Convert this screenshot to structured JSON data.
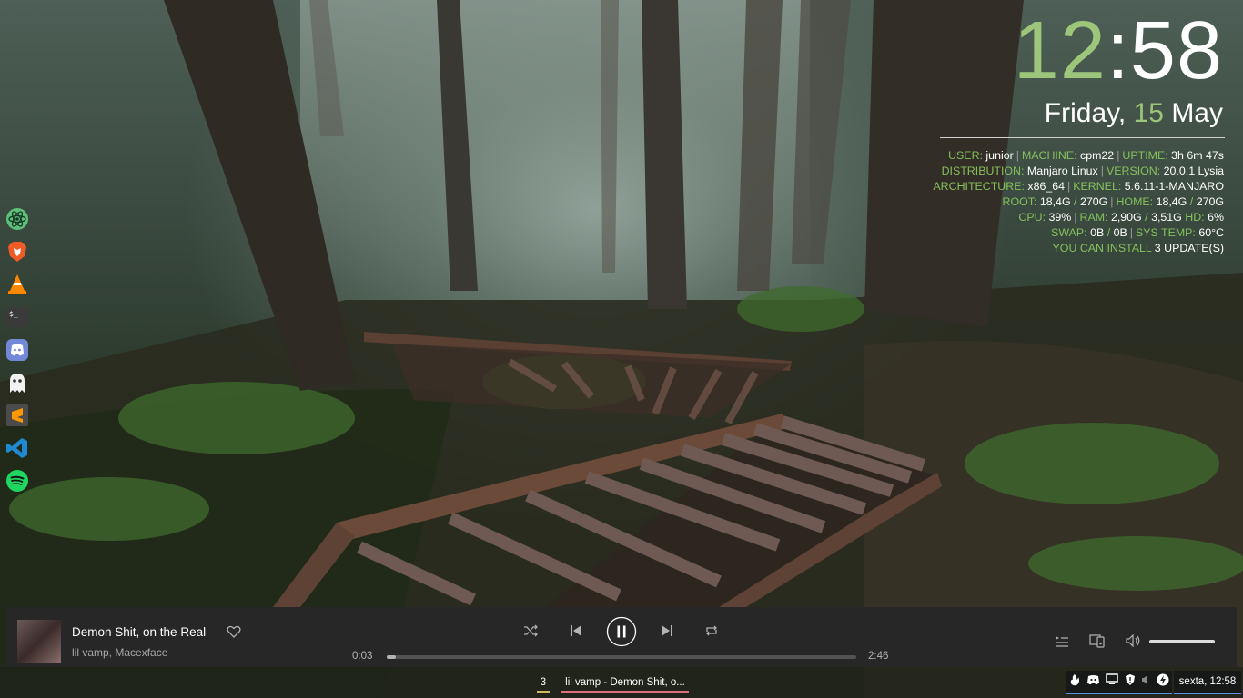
{
  "clock": {
    "hours": "12",
    "colon": ":",
    "minutes": "58"
  },
  "date": {
    "weekday": "Friday,",
    "day": "15",
    "month": "May"
  },
  "sysinfo": {
    "user_k": "USER:",
    "user_v": "junior",
    "machine_k": "MACHINE:",
    "machine_v": "cpm22",
    "uptime_k": "UPTIME:",
    "uptime_v": "3h 6m 47s",
    "dist_k": "DISTRIBUTION:",
    "dist_v": "Manjaro Linux",
    "ver_k": "VERSION:",
    "ver_v": "20.0.1 Lysia",
    "arch_k": "ARCHITECTURE:",
    "arch_v": "x86_64",
    "kernel_k": "KERNEL:",
    "kernel_v": "5.6.11-1-MANJARO",
    "root_k": "ROOT:",
    "root_used": "18,4G",
    "root_total": "270G",
    "home_k": "HOME:",
    "home_used": "18,4G",
    "home_total": "270G",
    "cpu_k": "CPU:",
    "cpu_v": "39%",
    "ram_k": "RAM:",
    "ram_used": "2,90G",
    "ram_total": "3,51G",
    "hd_k": "HD:",
    "hd_v": "6%",
    "swap_k": "SWAP:",
    "swap_used": "0B",
    "swap_total": "0B",
    "temp_k": "SYS TEMP:",
    "temp_v": "60°C",
    "updates_k": "YOU CAN INSTALL",
    "updates_v": "3 UPDATE(S)",
    "pipe": "|",
    "slash": "/"
  },
  "dock": [
    "atom-icon",
    "brave-icon",
    "vlc-icon",
    "terminal-icon",
    "discord-icon",
    "ghost-icon",
    "sublime-text-icon",
    "vscode-icon",
    "spotify-icon"
  ],
  "player": {
    "title": "Demon Shit, on the Real",
    "artist": "lil vamp, Macexface",
    "elapsed": "0:03",
    "duration": "2:46",
    "progress": 0.02,
    "volume": 1.0
  },
  "taskbar": {
    "workspace": "3",
    "task": "lil vamp - Demon Shit, o...",
    "clock": "sexta, 12:58",
    "tray_icons": [
      "flame-icon",
      "discord-icon",
      "monitor-icon",
      "shield-icon",
      "volume-icon",
      "power-icon"
    ]
  },
  "colors": {
    "accent_green": "#86c05c",
    "player_bg": "#272727",
    "tray_underline": "#5b8fe0",
    "workspace_underline": "#d6b65a",
    "task_underline": "#e06f7b"
  }
}
